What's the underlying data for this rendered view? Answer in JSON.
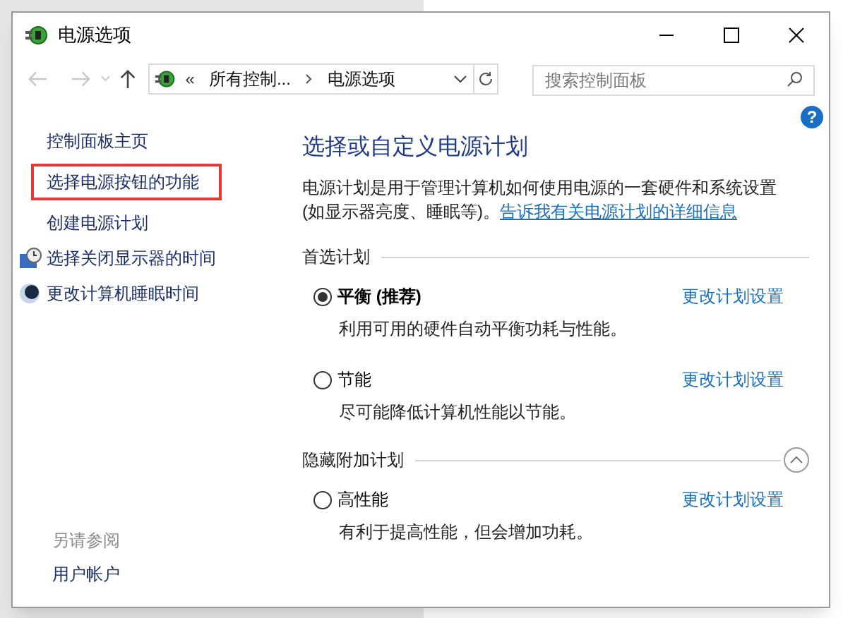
{
  "window": {
    "title": "电源选项"
  },
  "address_bar": {
    "overflow": "«",
    "segments": [
      "所有控制...",
      "电源选项"
    ]
  },
  "search": {
    "placeholder": "搜索控制面板"
  },
  "help_glyph": "?",
  "sidebar": {
    "items": [
      {
        "label": "控制面板主页",
        "kind": "plain",
        "highlighted": false
      },
      {
        "label": "选择电源按钮的功能",
        "kind": "plain",
        "highlighted": true
      },
      {
        "label": "创建电源计划",
        "kind": "plain",
        "highlighted": false
      },
      {
        "label": "选择关闭显示器的时间",
        "kind": "display",
        "highlighted": false
      },
      {
        "label": "更改计算机睡眠时间",
        "kind": "sleep",
        "highlighted": false
      }
    ],
    "see_also": {
      "heading": "另请参阅",
      "items": [
        "用户帐户"
      ]
    }
  },
  "main": {
    "heading": "选择或自定义电源计划",
    "description": "电源计划是用于管理计算机如何使用电源的一套硬件和系统设置(如显示器亮度、睡眠等)。",
    "link": "告诉我有关电源计划的详细信息",
    "sections": [
      {
        "title": "首选计划",
        "collapse_button": false,
        "plans": [
          {
            "name": "平衡 (推荐)",
            "selected": true,
            "description": "利用可用的硬件自动平衡功耗与性能。",
            "action": "更改计划设置"
          },
          {
            "name": "节能",
            "selected": false,
            "description": "尽可能降低计算机性能以节能。",
            "action": "更改计划设置"
          }
        ]
      },
      {
        "title": "隐藏附加计划",
        "collapse_button": true,
        "plans": [
          {
            "name": "高性能",
            "selected": false,
            "description": "有利于提高性能，但会增加功耗。",
            "action": "更改计划设置"
          }
        ]
      }
    ]
  }
}
